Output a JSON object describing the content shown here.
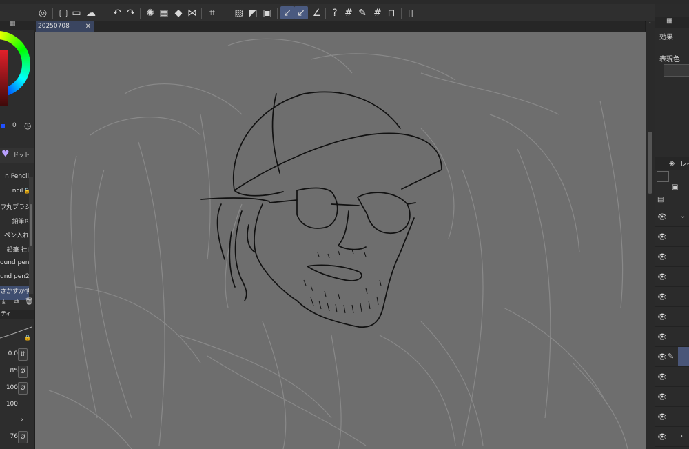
{
  "toolbar": {
    "icons": [
      "app-logo-icon",
      "new-file-icon",
      "open-folder-icon",
      "cloud-icon",
      "undo-icon",
      "redo-icon",
      "loading-icon",
      "clear-icon",
      "fill-icon",
      "flip-icon",
      "transform-icon",
      "selection-icon",
      "ruler-snap-icon",
      "pen-straighten-icon",
      "brush-curve-icon",
      "perspective-icon",
      "help-icon",
      "grid-icon",
      "pen-icon",
      "grid-2-icon",
      "ruler-icon",
      "phone-icon"
    ]
  },
  "left_panel": {
    "color_values": {
      "blue": "0",
      "alpha": "0"
    },
    "brush_category": "ドット",
    "brushes": [
      "n Pencil",
      "ncil 2",
      "ワ丸ブラシ",
      "鉛筆R",
      "ペン入れ",
      "鉛筆 社I",
      "ound pen",
      "und pen2",
      "さかすかす"
    ],
    "selected_brush_index": 8,
    "tool_property_label": "ティ",
    "properties": [
      {
        "value": "0.0",
        "btn": "⇵"
      },
      {
        "value": "85",
        "btn": "Ø"
      },
      {
        "value": "100",
        "btn": "Ø"
      },
      {
        "value": "100",
        "btn": ""
      },
      {
        "value": "",
        "btn": "›"
      },
      {
        "value": "76",
        "btn": "Ø"
      }
    ]
  },
  "document": {
    "tab_title": "20250708",
    "close_glyph": "✕"
  },
  "right_panel": {
    "effect_label": "効果",
    "expression_color_label": "表現色",
    "layer_label": "レイ"
  },
  "colors": {
    "canvas": "#6e6e6e",
    "selection": "#3f4e70",
    "layer_selected": "#4a5678"
  }
}
